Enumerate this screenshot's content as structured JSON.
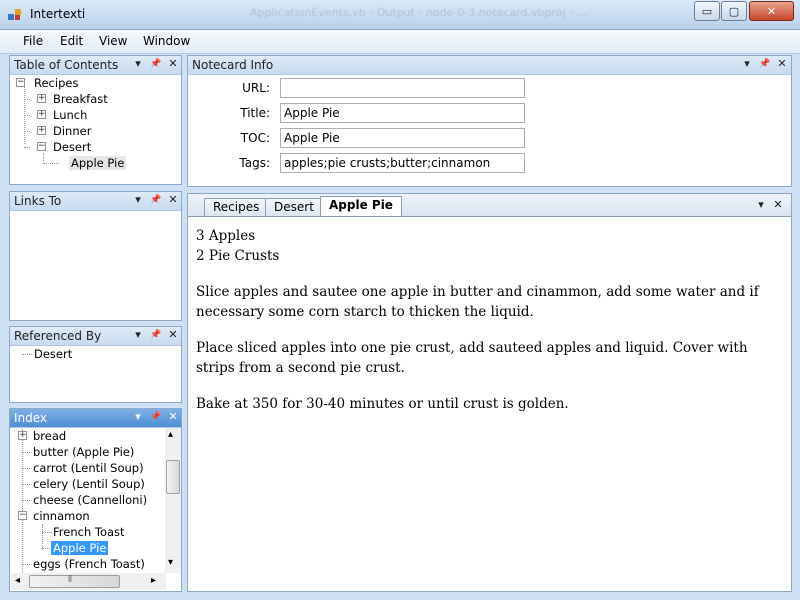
{
  "window": {
    "title": "Intertexti",
    "background_taskbar_text": "ApplicationEvents.vb - Output - node-0-3.notecard.vbproj - ...",
    "controls": {
      "minimize": "▭",
      "maximize": "▢",
      "close": "✕"
    }
  },
  "menu": [
    "File",
    "Edit",
    "View",
    "Window"
  ],
  "toc": {
    "title": "Table of Contents",
    "items": [
      {
        "label": "Recipes",
        "expander": "−"
      },
      {
        "label": "Breakfast",
        "expander": "+"
      },
      {
        "label": "Lunch",
        "expander": "+"
      },
      {
        "label": "Dinner",
        "expander": "+"
      },
      {
        "label": "Desert",
        "expander": "−"
      },
      {
        "label": "Apple Pie"
      }
    ]
  },
  "links_to": {
    "title": "Links To",
    "items": []
  },
  "referenced_by": {
    "title": "Referenced By",
    "items": [
      "Desert"
    ]
  },
  "index": {
    "title": "Index",
    "items": [
      {
        "label": "bread",
        "expander": "+"
      },
      {
        "label": "butter (Apple Pie)"
      },
      {
        "label": "carrot (Lentil Soup)"
      },
      {
        "label": "celery (Lentil Soup)"
      },
      {
        "label": "cheese (Cannelloni)"
      },
      {
        "label": "cinnamon",
        "expander": "−"
      },
      {
        "label": "French Toast"
      },
      {
        "label": "Apple Pie"
      },
      {
        "label": "eggs (French Toast)"
      }
    ]
  },
  "notecard_info": {
    "title": "Notecard Info",
    "url_label": "URL:",
    "url_value": "",
    "title_label": "Title:",
    "title_value": "Apple Pie",
    "toc_label": "TOC:",
    "toc_value": "Apple Pie",
    "tags_label": "Tags:",
    "tags_value": "apples;pie crusts;butter;cinnamon"
  },
  "tabs": [
    "Recipes",
    "Desert",
    "Apple Pie"
  ],
  "active_tab": "Apple Pie",
  "content": {
    "line1": "3 Apples",
    "line2": "2 Pie Crusts",
    "para1": "Slice apples and sautee one apple in butter and cinammon, add some water and if necessary some corn starch to thicken the liquid.",
    "para2": "Place sliced apples into one pie crust, add sauteed apples and liquid.  Cover with strips from a second pie crust.",
    "para3": "Bake at 350 for 30-40 minutes or until crust is golden."
  },
  "icons": {
    "dropdown": "▾",
    "pin": "📌",
    "close": "✕",
    "scroll_up": "▴",
    "scroll_down": "▾",
    "scroll_left": "◂",
    "scroll_right": "▸",
    "grip": "⦀"
  },
  "colors": {
    "selection": "#3399ff",
    "panel_border": "#8ea8c8",
    "active_header": "#4f8ed6"
  }
}
